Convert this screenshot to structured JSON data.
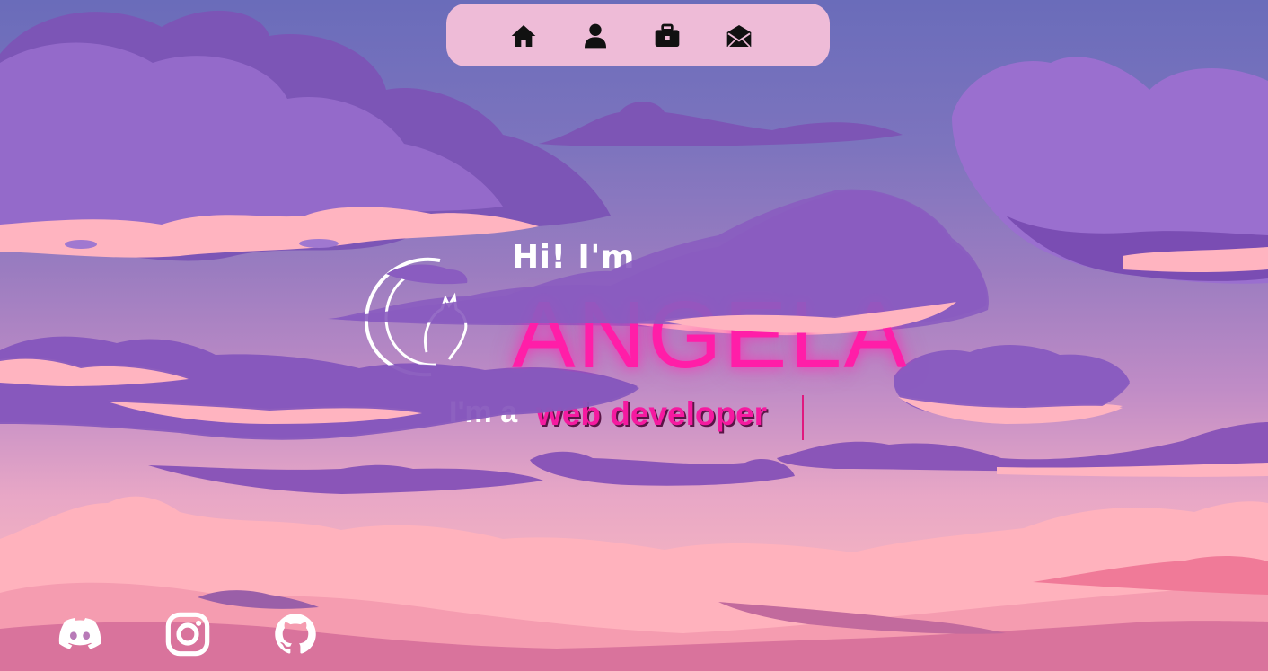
{
  "colors": {
    "nav_bg": "#eebbd7",
    "accent_pink": "#ff1ea8",
    "cloud_purple": "#8a5cc0",
    "cloud_pink": "#f7b0bf",
    "text_white": "#ffffff"
  },
  "nav": {
    "items": [
      {
        "icon": "home-icon"
      },
      {
        "icon": "user-icon"
      },
      {
        "icon": "briefcase-icon"
      },
      {
        "icon": "mail-icon"
      }
    ]
  },
  "hero": {
    "greeting": "Hi! I'm",
    "name": "ANGELA",
    "role_prefix": "I'm a",
    "role_word": "web developer"
  },
  "social": {
    "items": [
      {
        "icon": "discord-icon"
      },
      {
        "icon": "instagram-icon"
      },
      {
        "icon": "github-icon"
      }
    ]
  }
}
